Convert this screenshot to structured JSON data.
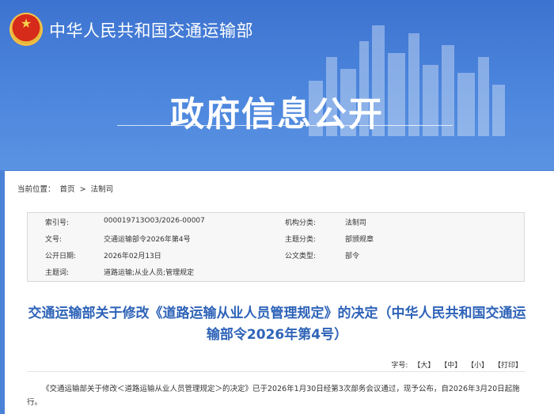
{
  "header": {
    "site_name": "中华人民共和国交通运输部",
    "hero_title": "政府信息公开"
  },
  "breadcrumb": {
    "label": "当前位置：",
    "home": "首页",
    "separator": ">",
    "section": "法制司"
  },
  "meta": {
    "index_label": "索引号:",
    "index_value": "000019713O03/2026-00007",
    "org_label": "机构分类:",
    "org_value": "法制司",
    "docno_label": "文号:",
    "docno_value": "交通运输部令2026年第4号",
    "topic_label": "主题分类:",
    "topic_value": "部颁规章",
    "date_label": "公开日期:",
    "date_value": "2026年02月13日",
    "type_label": "公文类型:",
    "type_value": "部令",
    "keywords_label": "主题词:",
    "keywords_value": "道路运输;从业人员;管理规定"
  },
  "article": {
    "title": "交通运输部关于修改《道路运输从业人员管理规定》的决定（中华人民共和国交通运输部令2026年第4号）",
    "font_size_label": "字号:",
    "font_large": "【大】",
    "font_medium": "【中】",
    "font_small": "【小】",
    "print": "【打印】",
    "body": "《交通运输部关于修改＜道路运输从业人员管理规定＞的决定》已于2026年1月30日经第3次部务会议通过，现予公布，自2026年3月20日起施行。"
  },
  "colors": {
    "banner": "#4a82d8",
    "title_blue": "#2e63b8"
  }
}
